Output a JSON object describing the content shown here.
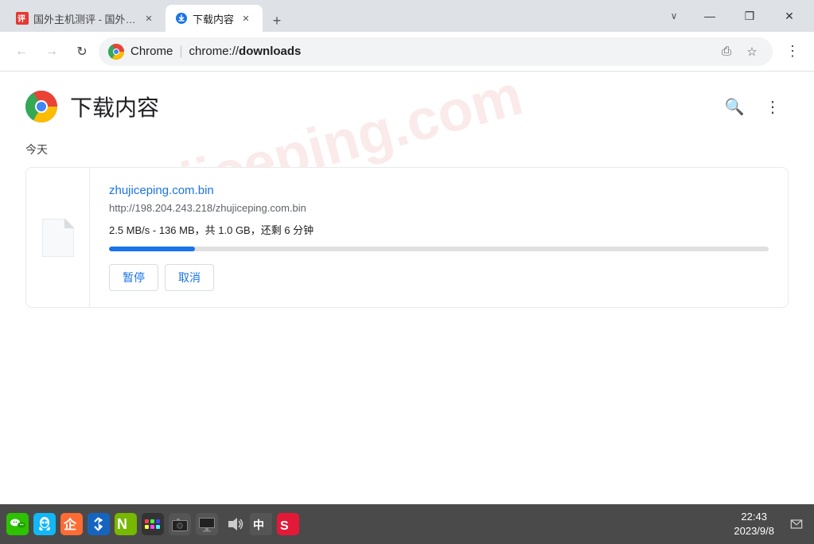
{
  "titlebar": {
    "tab1": {
      "title": "国外主机测评 - 国外VPS,",
      "active": false
    },
    "tab2": {
      "title": "下载内容",
      "active": true
    },
    "new_tab_label": "+",
    "chevron_label": "∨",
    "win_minimize": "—",
    "win_restore": "❒",
    "win_close": "✕"
  },
  "navbar": {
    "back_label": "←",
    "forward_label": "→",
    "reload_label": "↻",
    "address_brand": "Chrome",
    "address_divider": "|",
    "address_url": "chrome://downloads",
    "share_label": "⎙",
    "bookmark_label": "☆",
    "menu_label": "⋮"
  },
  "page": {
    "title": "下载内容",
    "watermark": "zhujiceping.com",
    "section_today": "今天",
    "search_label": "🔍",
    "more_label": "⋮"
  },
  "download": {
    "filename": "zhujiceping.com.bin",
    "url": "http://198.204.243.218/zhujiceping.com.bin",
    "status": "2.5 MB/s - 136 MB，共 1.0 GB，还剩 6 分钟",
    "progress_percent": 13,
    "pause_label": "暂停",
    "cancel_label": "取消"
  },
  "taskbar": {
    "icons": [
      "wechat",
      "qq",
      "tencent-app",
      "bluetooth",
      "nvidia",
      "color-app",
      "camera",
      "monitor",
      "volume",
      "input-method",
      "sogou"
    ],
    "time": "22:43",
    "date": "2023/9/8",
    "notification_label": "🔔"
  }
}
